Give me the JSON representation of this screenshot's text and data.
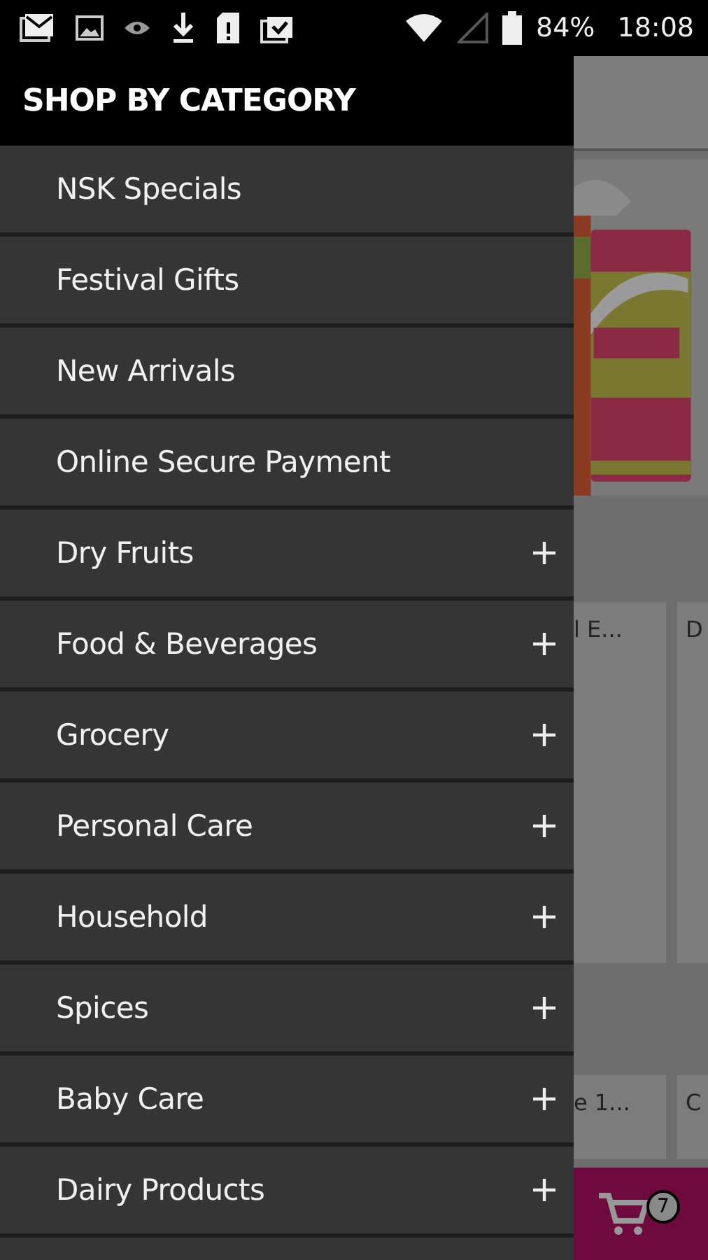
{
  "status_bar": {
    "battery": "84%",
    "time": "18:08"
  },
  "drawer": {
    "title": "SHOP BY CATEGORY",
    "items": [
      {
        "label": "NSK Specials",
        "expandable": false
      },
      {
        "label": "Festival Gifts",
        "expandable": false
      },
      {
        "label": "New Arrivals",
        "expandable": false
      },
      {
        "label": "Online Secure Payment",
        "expandable": false
      },
      {
        "label": "Dry Fruits",
        "expandable": true
      },
      {
        "label": "Food & Beverages",
        "expandable": true
      },
      {
        "label": "Grocery",
        "expandable": true
      },
      {
        "label": "Personal Care",
        "expandable": true
      },
      {
        "label": "Household",
        "expandable": true
      },
      {
        "label": "Spices",
        "expandable": true
      },
      {
        "label": "Baby Care",
        "expandable": true
      },
      {
        "label": "Dairy Products",
        "expandable": true
      }
    ]
  },
  "background": {
    "products": [
      {
        "name": "l E..."
      },
      {
        "name": "D"
      }
    ],
    "products_lower": [
      {
        "name": "e 1..."
      },
      {
        "name": "C"
      }
    ],
    "cart_count": "7"
  }
}
